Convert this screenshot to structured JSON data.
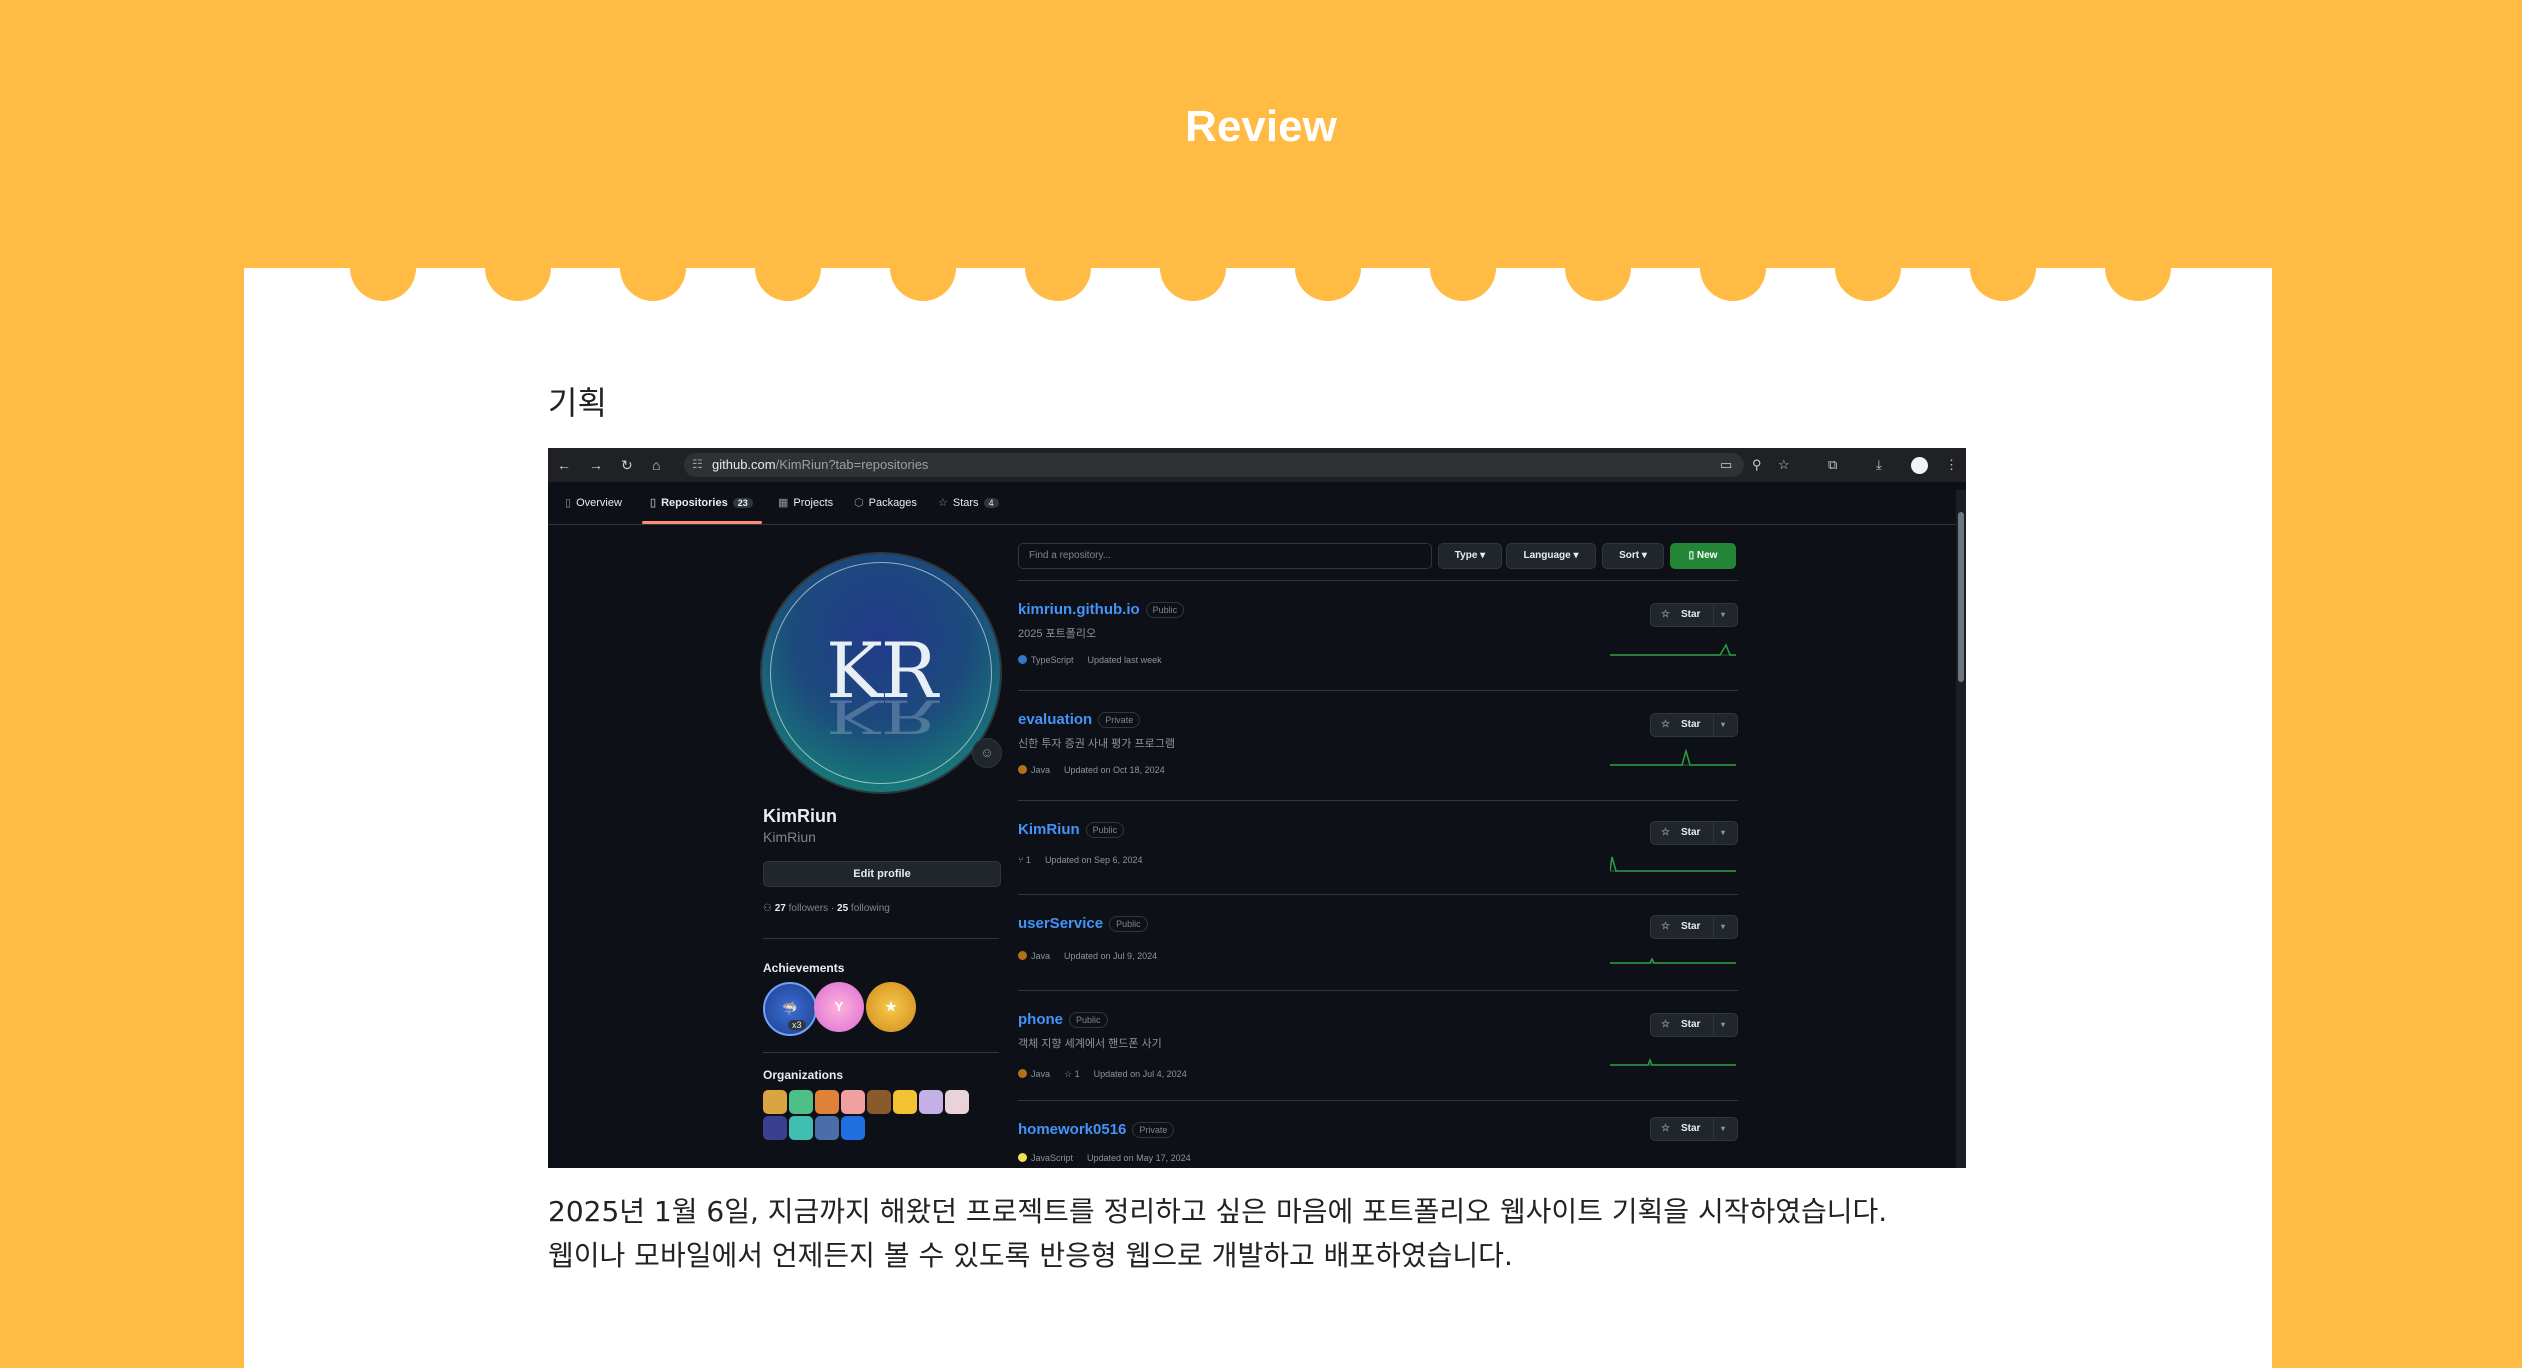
{
  "page": {
    "title": "Review",
    "section_label": "기획",
    "description_lines": [
      "2025년 1월 6일, 지금까지 해왔던 프로젝트를 정리하고 싶은 마음에 포트폴리오 웹사이트 기획을 시작하였습니다.",
      "웹이나 모바일에서 언제든지 볼 수 있도록 반응형 웹으로 개발하고 배포하였습니다."
    ]
  },
  "colors": {
    "page_background": "#FFBB44",
    "card": "#FFFFFF",
    "github_bg": "#0d1117",
    "link_blue": "#4493f8",
    "new_button_green": "#238636",
    "tab_underline": "#fd8c73"
  },
  "browser": {
    "url_domain": "github.com",
    "url_path": "/KimRiun?tab=repositories",
    "nav_icons": [
      "back-arrow-icon",
      "forward-arrow-icon",
      "reload-icon",
      "home-icon"
    ],
    "toolbar_icons": [
      "cast-icon",
      "zoom-icon",
      "bookmark-star-icon",
      "extensions-icon",
      "download-icon",
      "profile-icon",
      "kebab-menu-icon"
    ]
  },
  "github": {
    "tabs": [
      {
        "label": "Overview",
        "icon": "book-icon"
      },
      {
        "label": "Repositories",
        "count": "23",
        "icon": "repo-icon",
        "active": true
      },
      {
        "label": "Projects",
        "icon": "table-icon"
      },
      {
        "label": "Packages",
        "icon": "package-icon"
      },
      {
        "label": "Stars",
        "count": "4",
        "icon": "star-icon"
      }
    ],
    "profile": {
      "avatar_text": "KR",
      "name": "KimRiun",
      "login": "KimRiun",
      "edit_profile": "Edit profile",
      "followers_count": "27",
      "followers_label": "followers",
      "following_count": "25",
      "following_label": "following",
      "achievements_heading": "Achievements",
      "achievement_multiplier": "x3",
      "organizations_heading": "Organizations",
      "org_count": 13
    },
    "search": {
      "placeholder": "Find a repository..."
    },
    "filters": {
      "type": "Type",
      "language": "Language",
      "sort": "Sort",
      "new": "New"
    },
    "star_label": "Star",
    "repos": [
      {
        "name": "kimriun.github.io",
        "visibility": "Public",
        "description": "2025 포트폴리오",
        "language": "TypeScript",
        "language_color": "#3178c6",
        "forks": "",
        "updated": "Updated last week"
      },
      {
        "name": "evaluation",
        "visibility": "Private",
        "description": "신한 투자 증권 사내 평가 프로그램",
        "language": "Java",
        "language_color": "#b07219",
        "forks": "",
        "updated": "Updated on Oct 18, 2024"
      },
      {
        "name": "KimRiun",
        "visibility": "Public",
        "description": "",
        "language": "",
        "language_color": "",
        "forks": "1",
        "updated": "Updated on Sep 6, 2024"
      },
      {
        "name": "userService",
        "visibility": "Public",
        "description": "",
        "language": "Java",
        "language_color": "#b07219",
        "forks": "",
        "updated": "Updated on Jul 9, 2024"
      },
      {
        "name": "phone",
        "visibility": "Public",
        "description": "객체 지향 세계에서 핸드폰 사기",
        "language": "Java",
        "language_color": "#b07219",
        "forks": "1",
        "updated": "Updated on Jul 4, 2024"
      },
      {
        "name": "homework0516",
        "visibility": "Private",
        "description": "",
        "language": "JavaScript",
        "language_color": "#f1e05a",
        "forks": "",
        "updated": "Updated on May 17, 2024"
      }
    ]
  }
}
